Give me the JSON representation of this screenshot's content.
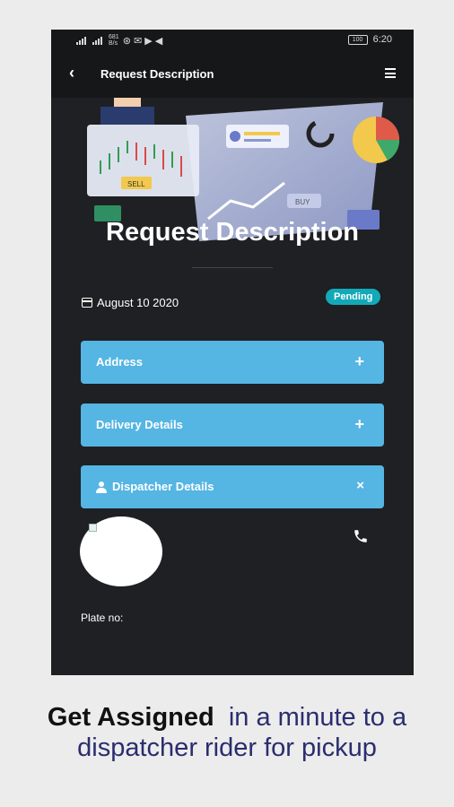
{
  "status_bar": {
    "mini_text": "681\nB/s",
    "battery": "100",
    "time": "6:20"
  },
  "app_bar": {
    "back_icon": "chevron-left-icon",
    "title": "Request Description",
    "menu_icon": "hamburger-menu-icon"
  },
  "hero": {
    "title": "Request Description",
    "chart_labels": [
      "SELL",
      "BUY"
    ]
  },
  "request": {
    "date": "August 10 2020",
    "status": "Pending",
    "status_color": "#14a9b8"
  },
  "sections": [
    {
      "label": "Address",
      "icon": "plus-icon",
      "toggle": "+"
    },
    {
      "label": "Delivery Details",
      "icon": "plus-icon",
      "toggle": "+"
    },
    {
      "label": "Dispatcher Details",
      "icon": "close-icon",
      "toggle": "×"
    }
  ],
  "dispatcher": {
    "plate_label": "Plate no:"
  },
  "caption": {
    "bold": "Get Assigned",
    "rest": "  in a minute to a dispatcher rider for pickup"
  },
  "colors": {
    "accent": "#55b5e3",
    "background": "#1f2023",
    "caption_text": "#2a2d6e"
  }
}
